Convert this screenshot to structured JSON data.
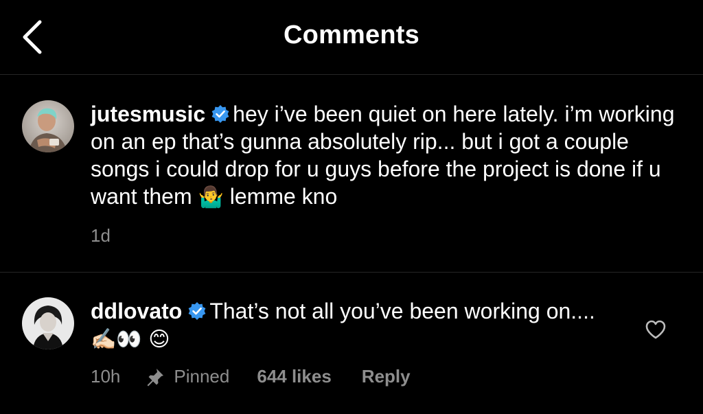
{
  "header": {
    "title": "Comments",
    "back_icon": "chevron-left-icon"
  },
  "comments": [
    {
      "username": "jutesmusic",
      "verified": true,
      "text_before_emoji": "hey i’ve been quiet on here lately. i’m working on an ep that’s gunna absolutely rip... but i got a couple songs i could drop for u guys before the project is done if u want them ",
      "emoji": "🤷‍♂️",
      "text_after_emoji": " lemme kno",
      "time": "1d"
    },
    {
      "username": "ddlovato",
      "verified": true,
      "text": "That’s not all you’ve been working on.... ",
      "emojis": "✍🏻👀 😊",
      "time": "10h",
      "pinned_label": "Pinned",
      "likes": "644 likes",
      "reply_label": "Reply",
      "like_icon": "heart-outline-icon"
    }
  ],
  "colors": {
    "background": "#000000",
    "text": "#ffffff",
    "secondary_text": "#8e8e8e",
    "verified_badge": "#3897f0",
    "divider": "#262626"
  }
}
